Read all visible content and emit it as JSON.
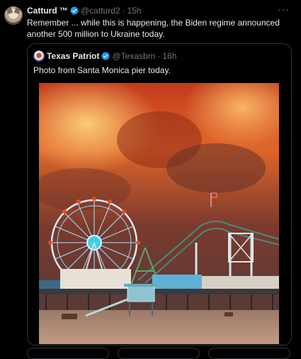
{
  "tweet": {
    "author_name": "Catturd ™",
    "handle": "@catturd2",
    "separator": "·",
    "time": "15h",
    "more_glyph": "···",
    "text": "Remember ... while this is happening, the Biden regime announced another 500 million to Ukraine today."
  },
  "quote": {
    "author_name": "Texas Patriot",
    "handle": "@Texasbrn",
    "separator": "·",
    "time": "16h",
    "text": "Photo from Santa Monica pier today."
  },
  "colors": {
    "verified": "#1d9bf0",
    "background": "#000000",
    "border": "#2f3336",
    "secondary_text": "#71767b"
  }
}
